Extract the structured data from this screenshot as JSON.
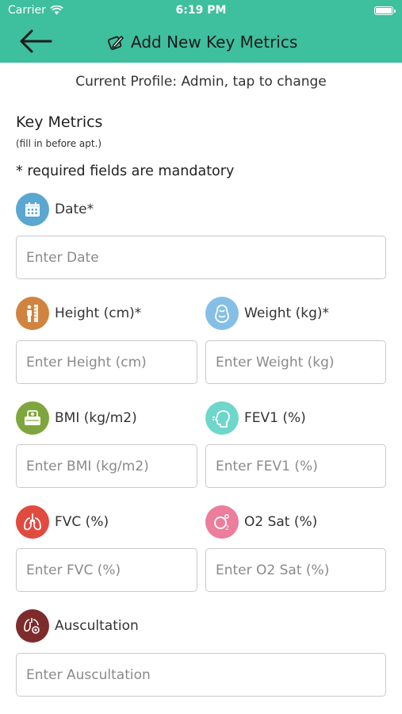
{
  "status_bar": {
    "carrier": "Carrier",
    "time": "6:19 PM"
  },
  "header": {
    "title": "Add New Key Metrics",
    "back_icon": "arrow-left-icon",
    "title_icon": "pencil-edit-icon",
    "color": "#3ebf9d"
  },
  "profile_text": "Current Profile: Admin, tap to change",
  "section": {
    "title": "Key Metrics",
    "subtitle": "(fill in before apt.)",
    "required_note": "* required fields are mandatory"
  },
  "fields": {
    "date": {
      "label": "Date*",
      "placeholder": "Enter Date",
      "icon": "calendar-icon",
      "icon_color": "#5aa7cf"
    },
    "height": {
      "label": "Height (cm)*",
      "placeholder": "Enter Height (cm)",
      "icon": "height-measure-icon",
      "icon_color": "#d0843f"
    },
    "weight": {
      "label": "Weight (kg)*",
      "placeholder": "Enter Weight (kg)",
      "icon": "weight-body-icon",
      "icon_color": "#86bfe6"
    },
    "bmi": {
      "label": "BMI (kg/m2)",
      "placeholder": "Enter BMI (kg/m2)",
      "icon": "scale-icon",
      "icon_color": "#7fa63d"
    },
    "fev1": {
      "label": "FEV1 (%)",
      "placeholder": "Enter FEV1 (%)",
      "icon": "breath-head-icon",
      "icon_color": "#6fd6cc"
    },
    "fvc": {
      "label": "FVC (%)",
      "placeholder": "Enter FVC (%)",
      "icon": "lungs-icon",
      "icon_color": "#e04a3f"
    },
    "o2sat": {
      "label": "O2 Sat (%)",
      "placeholder": "Enter O2 Sat (%)",
      "icon": "oxygen-icon",
      "icon_color": "#ec7d9c"
    },
    "auscultation": {
      "label": "Auscultation",
      "placeholder": "Enter Auscultation",
      "icon": "stethoscope-lungs-icon",
      "icon_color": "#7d2b2b"
    }
  }
}
